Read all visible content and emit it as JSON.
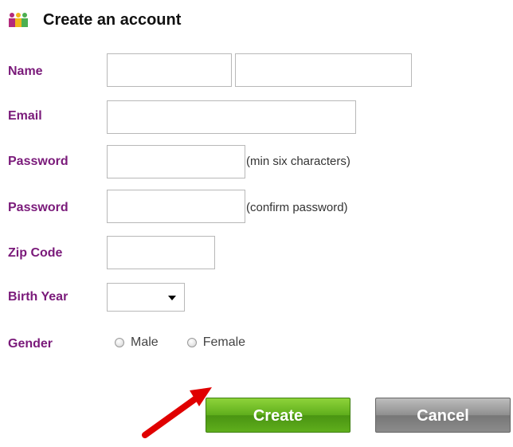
{
  "header": {
    "title": "Create an account",
    "icon": "people-icon"
  },
  "form": {
    "labels": {
      "name": "Name",
      "email": "Email",
      "password": "Password",
      "confirm_password": "Password",
      "zip": "Zip Code",
      "birth_year": "Birth Year",
      "gender": "Gender"
    },
    "values": {
      "first_name": "",
      "last_name": "",
      "email": "",
      "password": "",
      "confirm_password": "",
      "zip": "",
      "birth_year_selected": ""
    },
    "hints": {
      "password": "(min six characters)",
      "confirm_password": "(confirm password)"
    },
    "gender_options": [
      "Male",
      "Female"
    ]
  },
  "actions": {
    "create_label": "Create",
    "cancel_label": "Cancel"
  },
  "colors": {
    "label_purple": "#7a1a7a",
    "create_green": "#5fae1c",
    "cancel_gray": "#8f8f8f",
    "arrow_red": "#e00000"
  },
  "icons": {
    "arrow": "red-arrow-pointer-icon",
    "select_caret": "chevron-down-icon"
  }
}
